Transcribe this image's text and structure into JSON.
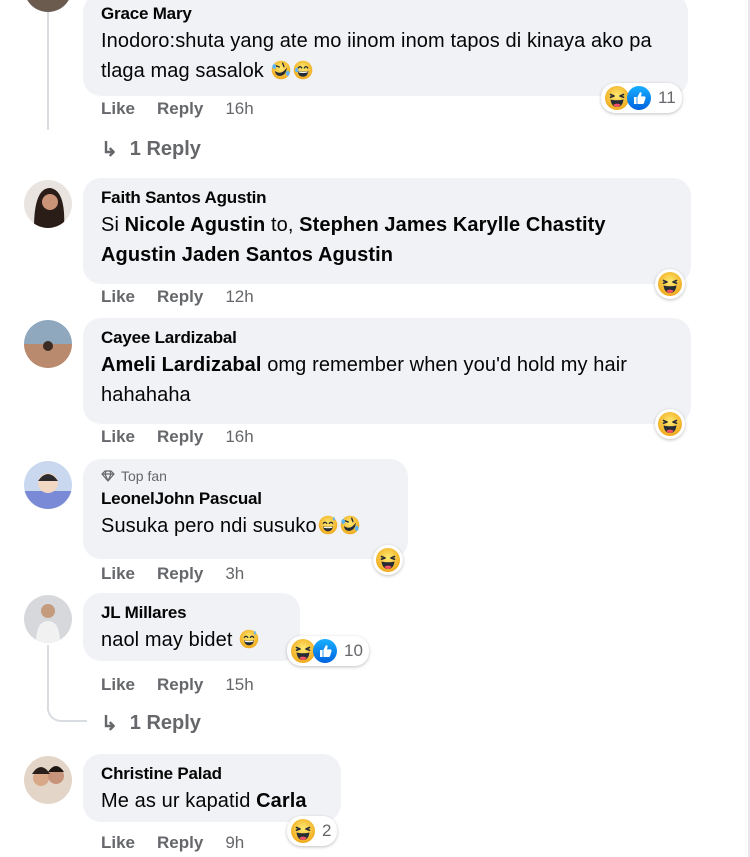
{
  "comments": [
    {
      "author": "Grace Mary",
      "text": "Inodoro:shuta yang ate mo iinom inom tapos di kinaya ako pa tlaga mag sasalok",
      "like": "Like",
      "reply": "Reply",
      "time": "16h",
      "reactions": [
        "haha-icon",
        "like-icon"
      ],
      "reaction_count": "11",
      "replies_label": "1 Reply"
    },
    {
      "author": "Faith Santos Agustin",
      "text_prefix": "Si ",
      "mention1": "Nicole Agustin",
      "text_mid": " to, ",
      "mention2": "Stephen James Karylle Chastity Agustin Jaden Santos Agustin",
      "like": "Like",
      "reply": "Reply",
      "time": "12h",
      "reactions": [
        "haha-icon"
      ]
    },
    {
      "author": "Cayee Lardizabal",
      "mention": "Ameli Lardizabal",
      "text": " omg remember when you'd hold my hair hahahaha",
      "like": "Like",
      "reply": "Reply",
      "time": "16h",
      "reactions": [
        "haha-icon"
      ]
    },
    {
      "badge": "Top fan",
      "author": "LeonelJohn Pascual",
      "text": "Susuka pero ndi susuko",
      "like": "Like",
      "reply": "Reply",
      "time": "3h",
      "reactions": [
        "haha-icon"
      ]
    },
    {
      "author": "JL Millares",
      "text": "naol may bidet",
      "like": "Like",
      "reply": "Reply",
      "time": "15h",
      "reactions": [
        "haha-icon",
        "like-icon"
      ],
      "reaction_count": "10",
      "replies_label": "1 Reply"
    },
    {
      "author": "Christine Palad",
      "text": "Me as ur kapatid ",
      "mention": "Carla",
      "like": "Like",
      "reply": "Reply",
      "time": "9h",
      "reactions": [
        "haha-icon"
      ],
      "reaction_count": "2"
    }
  ],
  "colors": {
    "bubble": "#f0f2f5",
    "secondary_text": "#65676b",
    "like_blue": "#1877f2",
    "haha_yellow": "#f7b125"
  }
}
